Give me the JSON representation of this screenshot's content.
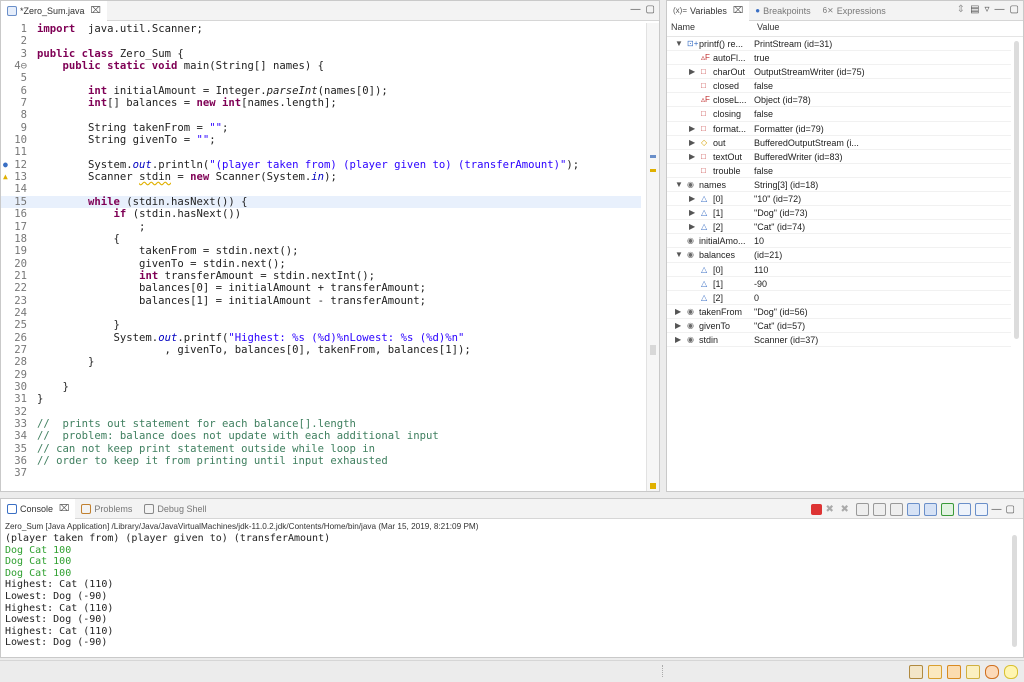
{
  "editor": {
    "tab_label": "*Zero_Sum.java",
    "close_glyph": "⌧",
    "lines": [
      {
        "n": "1",
        "parts": [
          [
            "kw",
            "import"
          ],
          [
            "",
            "  java.util.Scanner;"
          ]
        ]
      },
      {
        "n": "2",
        "parts": []
      },
      {
        "n": "3",
        "parts": [
          [
            "kw",
            "public class"
          ],
          [
            "",
            " Zero_Sum {"
          ]
        ]
      },
      {
        "n": "4⊖",
        "parts": [
          [
            "",
            "    "
          ],
          [
            "kw",
            "public static void"
          ],
          [
            "",
            " main(String[] names) {"
          ]
        ]
      },
      {
        "n": "5",
        "parts": []
      },
      {
        "n": "6",
        "parts": [
          [
            "",
            "        "
          ],
          [
            "kw",
            "int"
          ],
          [
            "",
            " initialAmount = Integer."
          ],
          [
            "ital",
            "parseInt"
          ],
          [
            "",
            "(names[0]);"
          ]
        ]
      },
      {
        "n": "7",
        "parts": [
          [
            "",
            "        "
          ],
          [
            "kw",
            "int"
          ],
          [
            "",
            "[] balances = "
          ],
          [
            "kw",
            "new int"
          ],
          [
            "",
            "[names.length];"
          ]
        ]
      },
      {
        "n": "8",
        "parts": []
      },
      {
        "n": "9",
        "parts": [
          [
            "",
            "        String takenFrom = "
          ],
          [
            "str",
            "\"\""
          ],
          [
            "",
            ";"
          ]
        ]
      },
      {
        "n": "10",
        "parts": [
          [
            "",
            "        String givenTo = "
          ],
          [
            "str",
            "\"\""
          ],
          [
            "",
            ";"
          ]
        ]
      },
      {
        "n": "11",
        "parts": []
      },
      {
        "n": "12",
        "parts": [
          [
            "",
            "        System."
          ],
          [
            "fld ital",
            "out"
          ],
          [
            "",
            ".println("
          ],
          [
            "str",
            "\"(player taken from) (player given to) (transferAmount)\""
          ],
          [
            "",
            ");"
          ]
        ]
      },
      {
        "n": "13",
        "parts": [
          [
            "",
            "        Scanner "
          ],
          [
            "warn",
            "stdin"
          ],
          [
            "",
            " = "
          ],
          [
            "kw",
            "new"
          ],
          [
            "",
            " Scanner(System."
          ],
          [
            "fld ital",
            "in"
          ],
          [
            "",
            ");"
          ]
        ]
      },
      {
        "n": "14",
        "parts": []
      },
      {
        "n": "15",
        "parts": [
          [
            "",
            "        "
          ],
          [
            "kw",
            "while"
          ],
          [
            "",
            " (stdin.hasNext()) {"
          ]
        ]
      },
      {
        "n": "16",
        "parts": [
          [
            "",
            "            "
          ],
          [
            "kw",
            "if"
          ],
          [
            "",
            " (stdin.hasNext())"
          ]
        ]
      },
      {
        "n": "17",
        "parts": [
          [
            "",
            "                ;"
          ]
        ]
      },
      {
        "n": "18",
        "parts": [
          [
            "",
            "            {"
          ]
        ]
      },
      {
        "n": "19",
        "parts": [
          [
            "",
            "                takenFrom = stdin.next();"
          ]
        ]
      },
      {
        "n": "20",
        "parts": [
          [
            "",
            "                givenTo = stdin.next();"
          ]
        ]
      },
      {
        "n": "21",
        "parts": [
          [
            "",
            "                "
          ],
          [
            "kw",
            "int"
          ],
          [
            "",
            " transferAmount = stdin.nextInt();"
          ]
        ]
      },
      {
        "n": "22",
        "parts": [
          [
            "",
            "                balances[0] = initialAmount + transferAmount;"
          ]
        ]
      },
      {
        "n": "23",
        "parts": [
          [
            "",
            "                balances[1] = initialAmount - transferAmount;"
          ]
        ]
      },
      {
        "n": "24",
        "parts": []
      },
      {
        "n": "25",
        "parts": [
          [
            "",
            "            }"
          ]
        ]
      },
      {
        "n": "26",
        "parts": [
          [
            "",
            "            System."
          ],
          [
            "fld ital",
            "out"
          ],
          [
            "",
            ".printf("
          ],
          [
            "str",
            "\"Highest: %s (%d)%nLowest: %s (%d)%n\""
          ]
        ]
      },
      {
        "n": "27",
        "parts": [
          [
            "",
            "                    , givenTo, balances[0], takenFrom, balances[1]);"
          ]
        ]
      },
      {
        "n": "28",
        "parts": [
          [
            "",
            "        }"
          ]
        ]
      },
      {
        "n": "29",
        "parts": []
      },
      {
        "n": "30",
        "parts": [
          [
            "",
            "    }"
          ]
        ]
      },
      {
        "n": "31",
        "parts": [
          [
            "",
            "}"
          ]
        ]
      },
      {
        "n": "32",
        "parts": []
      },
      {
        "n": "33",
        "parts": [
          [
            "cmt",
            "//  prints out statement for each balance[].length"
          ]
        ]
      },
      {
        "n": "34",
        "parts": [
          [
            "cmt",
            "//  problem: balance does not update with each additional input"
          ]
        ]
      },
      {
        "n": "35",
        "parts": [
          [
            "cmt",
            "// can not keep print statement outside while loop in"
          ]
        ]
      },
      {
        "n": "36",
        "parts": [
          [
            "cmt",
            "// order to keep it from printing until input exhausted"
          ]
        ]
      },
      {
        "n": "37",
        "parts": []
      }
    ]
  },
  "variables": {
    "tabs": [
      {
        "label": "Variables",
        "prefix": "(x)=",
        "active": true
      },
      {
        "label": "Breakpoints",
        "prefix": "●",
        "active": false
      },
      {
        "label": "Expressions",
        "prefix": "6⨯",
        "active": false
      }
    ],
    "col_name": "Name",
    "col_value": "Value",
    "rows": [
      {
        "indent": 0,
        "arrow": "▼",
        "icon": "⊡+",
        "icolor": "#3a6fc4",
        "name": "printf() re...",
        "value": "PrintStream  (id=31)"
      },
      {
        "indent": 1,
        "arrow": "",
        "icon": "▵F",
        "icolor": "#c03030",
        "name": "autoFl...",
        "value": "true"
      },
      {
        "indent": 1,
        "arrow": "▶",
        "icon": "□",
        "icolor": "#c03030",
        "name": "charOut",
        "value": "OutputStreamWriter  (id=75)"
      },
      {
        "indent": 1,
        "arrow": "",
        "icon": "□",
        "icolor": "#c03030",
        "name": "closed",
        "value": "false"
      },
      {
        "indent": 1,
        "arrow": "",
        "icon": "▵F",
        "icolor": "#c03030",
        "name": "closeL...",
        "value": "Object  (id=78)"
      },
      {
        "indent": 1,
        "arrow": "",
        "icon": "□",
        "icolor": "#c03030",
        "name": "closing",
        "value": "false"
      },
      {
        "indent": 1,
        "arrow": "▶",
        "icon": "□",
        "icolor": "#c03030",
        "name": "format...",
        "value": "Formatter  (id=79)"
      },
      {
        "indent": 1,
        "arrow": "▶",
        "icon": "◇",
        "icolor": "#d4a000",
        "name": "out",
        "value": "BufferedOutputStream  (i..."
      },
      {
        "indent": 1,
        "arrow": "▶",
        "icon": "□",
        "icolor": "#c03030",
        "name": "textOut",
        "value": "BufferedWriter  (id=83)"
      },
      {
        "indent": 1,
        "arrow": "",
        "icon": "□",
        "icolor": "#c03030",
        "name": "trouble",
        "value": "false"
      },
      {
        "indent": 0,
        "arrow": "▼",
        "icon": "◉",
        "icolor": "#6a6a6a",
        "name": "names",
        "value": "String[3]  (id=18)"
      },
      {
        "indent": 1,
        "arrow": "▶",
        "icon": "△",
        "icolor": "#3a6fc4",
        "name": "[0]",
        "value": "\"10\"  (id=72)"
      },
      {
        "indent": 1,
        "arrow": "▶",
        "icon": "△",
        "icolor": "#3a6fc4",
        "name": "[1]",
        "value": "\"Dog\"  (id=73)"
      },
      {
        "indent": 1,
        "arrow": "▶",
        "icon": "△",
        "icolor": "#3a6fc4",
        "name": "[2]",
        "value": "\"Cat\"  (id=74)"
      },
      {
        "indent": 0,
        "arrow": "",
        "icon": "◉",
        "icolor": "#6a6a6a",
        "name": "initialAmo...",
        "value": "10"
      },
      {
        "indent": 0,
        "arrow": "▼",
        "icon": "◉",
        "icolor": "#6a6a6a",
        "name": "balances",
        "value": "(id=21)"
      },
      {
        "indent": 1,
        "arrow": "",
        "icon": "△",
        "icolor": "#3a6fc4",
        "name": "[0]",
        "value": "110"
      },
      {
        "indent": 1,
        "arrow": "",
        "icon": "△",
        "icolor": "#3a6fc4",
        "name": "[1]",
        "value": "-90"
      },
      {
        "indent": 1,
        "arrow": "",
        "icon": "△",
        "icolor": "#3a6fc4",
        "name": "[2]",
        "value": "0"
      },
      {
        "indent": 0,
        "arrow": "▶",
        "icon": "◉",
        "icolor": "#6a6a6a",
        "name": "takenFrom",
        "value": "\"Dog\"  (id=56)"
      },
      {
        "indent": 0,
        "arrow": "▶",
        "icon": "◉",
        "icolor": "#6a6a6a",
        "name": "givenTo",
        "value": "\"Cat\"  (id=57)"
      },
      {
        "indent": 0,
        "arrow": "▶",
        "icon": "◉",
        "icolor": "#6a6a6a",
        "name": "stdin",
        "value": "Scanner  (id=37)"
      }
    ]
  },
  "console": {
    "tabs": [
      {
        "label": "Console",
        "active": true
      },
      {
        "label": "Problems",
        "active": false
      },
      {
        "label": "Debug Shell",
        "active": false
      }
    ],
    "launch_path": "Zero_Sum [Java Application] /Library/Java/JavaVirtualMachines/jdk-11.0.2.jdk/Contents/Home/bin/java (Mar 15, 2019, 8:21:09 PM)",
    "output": [
      {
        "t": "(player taken from) (player given to) (transferAmount)",
        "input": false
      },
      {
        "t": "Dog Cat 100",
        "input": true
      },
      {
        "t": "Dog Cat 100",
        "input": true
      },
      {
        "t": "Dog Cat 100",
        "input": true
      },
      {
        "t": "Highest: Cat (110)",
        "input": false
      },
      {
        "t": "Lowest: Dog (-90)",
        "input": false
      },
      {
        "t": "Highest: Cat (110)",
        "input": false
      },
      {
        "t": "Lowest: Dog (-90)",
        "input": false
      },
      {
        "t": "Highest: Cat (110)",
        "input": false
      },
      {
        "t": "Lowest: Dog (-90)",
        "input": false
      }
    ],
    "input_color": "#2fa030"
  }
}
